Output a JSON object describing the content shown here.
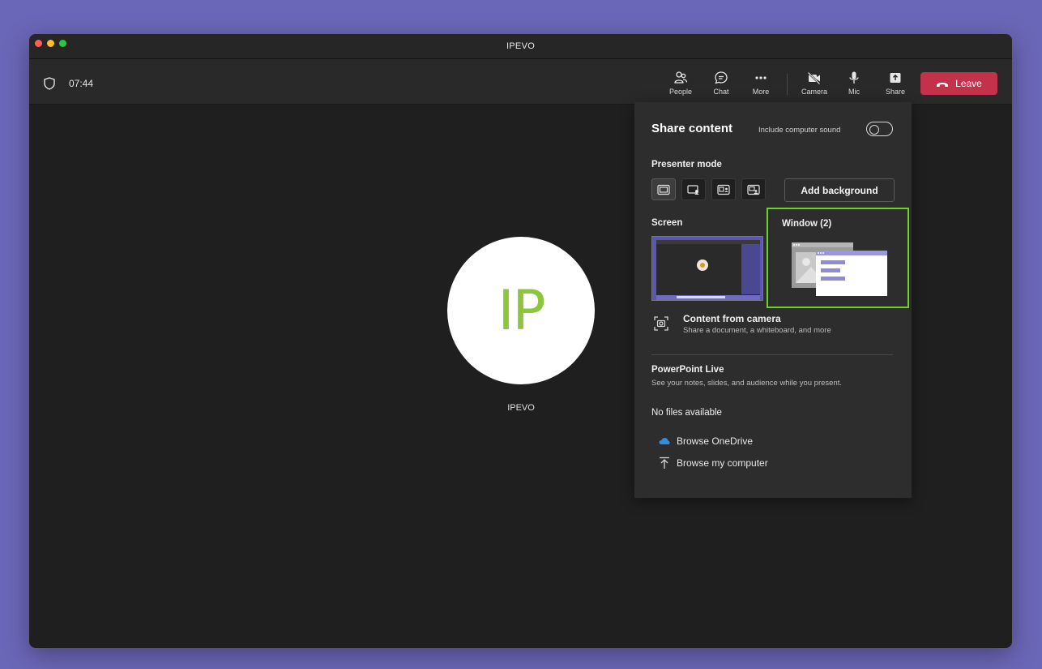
{
  "window": {
    "title": "IPEVO"
  },
  "toolbar": {
    "timer": "07:44",
    "people": "People",
    "chat": "Chat",
    "more": "More",
    "camera": "Camera",
    "mic": "Mic",
    "share": "Share",
    "leave": "Leave"
  },
  "participant": {
    "initials": "IP",
    "name": "IPEVO"
  },
  "share_panel": {
    "title": "Share content",
    "include_sound_label": "Include computer sound",
    "include_sound_on": false,
    "presenter_mode_label": "Presenter mode",
    "presenter_modes": [
      "content-only",
      "standout",
      "side-by-side",
      "reporter"
    ],
    "add_background": "Add background",
    "screen_label": "Screen",
    "window_label": "Window (2)",
    "camera_content_title": "Content from camera",
    "camera_content_sub": "Share a document, a whiteboard, and more",
    "ppt_title": "PowerPoint Live",
    "ppt_sub": "See your notes, slides, and audience while you present.",
    "no_files": "No files available",
    "browse_onedrive": "Browse OneDrive",
    "browse_computer": "Browse my computer"
  },
  "colors": {
    "accent_highlight": "#6ed21e",
    "leave_button": "#c4314b",
    "avatar_initials": "#8cc63f",
    "desktop_background": "#6b67b8"
  }
}
